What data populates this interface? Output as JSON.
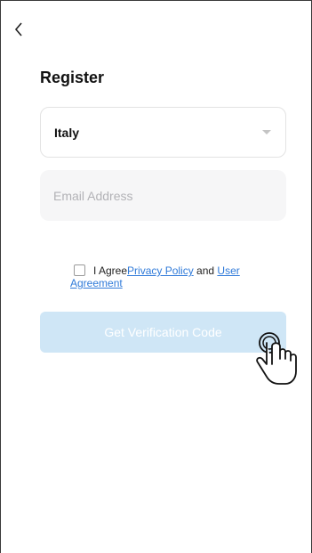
{
  "header": {
    "back_icon": "chevron-left-icon"
  },
  "title": "Register",
  "country_select": {
    "value": "Italy",
    "icon": "caret-down-icon"
  },
  "email_field": {
    "value": "",
    "placeholder": "Email Address"
  },
  "agreement": {
    "prefix": "I Agree",
    "privacy_link": "Privacy Policy",
    "conjunction": " and ",
    "agreement_link_part1": "User",
    "agreement_link_part2": "Agreement",
    "checked": false
  },
  "verify_button": {
    "label": "Get Verification Code",
    "enabled": false
  },
  "overlay": {
    "icon": "tap-hand-icon"
  },
  "colors": {
    "link": "#2f7ad9",
    "button_disabled": "#cfe6f6",
    "input_bg": "#f6f6f7"
  }
}
